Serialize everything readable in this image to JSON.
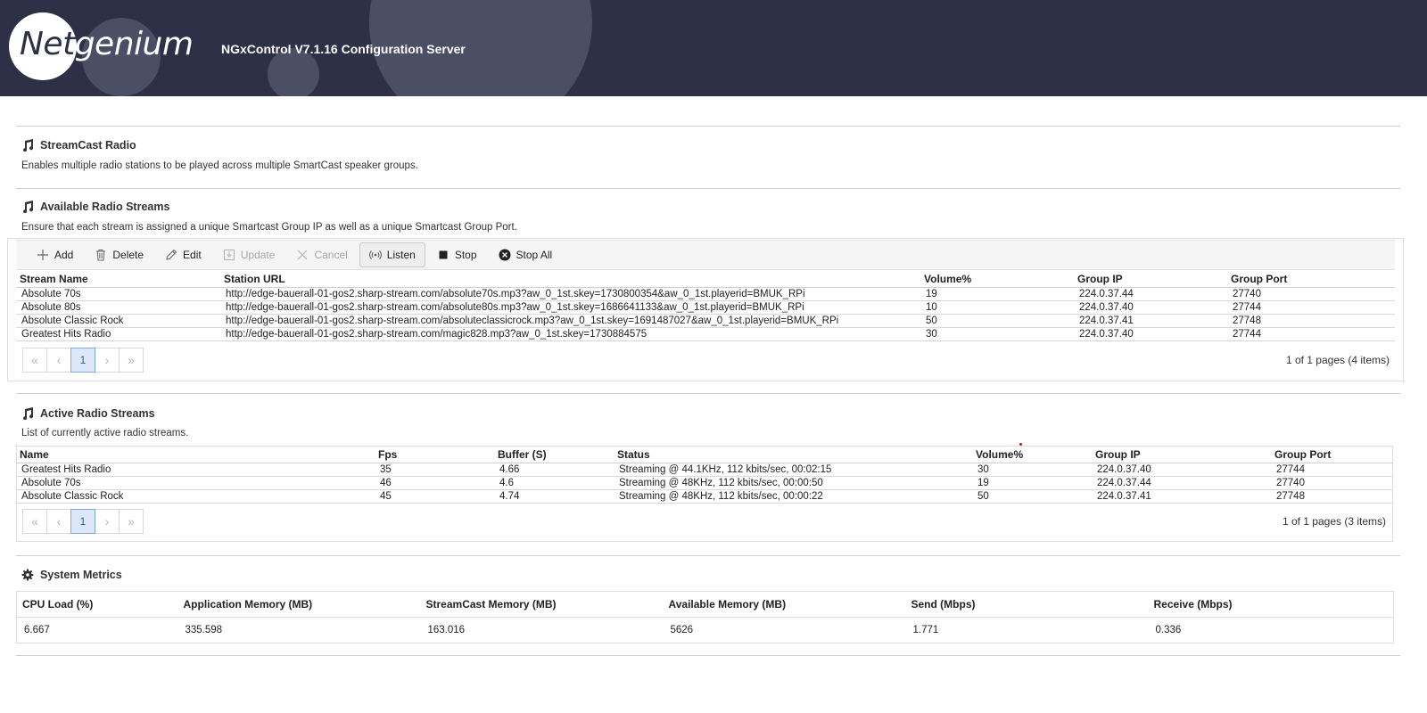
{
  "header": {
    "logo_part1": "Net",
    "logo_part2": "genium",
    "title": "NGxControl V7.1.16 Configuration Server"
  },
  "streamcast": {
    "title": "StreamCast Radio",
    "description": "Enables multiple radio stations to be played across multiple SmartCast speaker groups."
  },
  "available": {
    "title": "Available Radio Streams",
    "description": "Ensure that each stream is assigned a unique Smartcast Group IP as well as a unique Smartcast Group Port.",
    "toolbar": {
      "add": "Add",
      "delete": "Delete",
      "edit": "Edit",
      "update": "Update",
      "cancel": "Cancel",
      "listen": "Listen",
      "stop": "Stop",
      "stop_all": "Stop All"
    },
    "columns": [
      "Stream Name",
      "Station URL",
      "Volume%",
      "Group IP",
      "Group Port"
    ],
    "rows": [
      [
        "Absolute 70s",
        "http://edge-bauerall-01-gos2.sharp-stream.com/absolute70s.mp3?aw_0_1st.skey=1730800354&aw_0_1st.playerid=BMUK_RPi",
        "19",
        "224.0.37.44",
        "27740"
      ],
      [
        "Absolute 80s",
        "http://edge-bauerall-01-gos2.sharp-stream.com/absolute80s.mp3?aw_0_1st.skey=1686641133&aw_0_1st.playerid=BMUK_RPi",
        "10",
        "224.0.37.40",
        "27744"
      ],
      [
        "Absolute Classic Rock",
        "http://edge-bauerall-01-gos2.sharp-stream.com/absoluteclassicrock.mp3?aw_0_1st.skey=1691487027&aw_0_1st.playerid=BMUK_RPi",
        "50",
        "224.0.37.41",
        "27748"
      ],
      [
        "Greatest Hits Radio",
        "http://edge-bauerall-01-gos2.sharp-stream.com/magic828.mp3?aw_0_1st.skey=1730884575",
        "30",
        "224.0.37.40",
        "27744"
      ]
    ],
    "pager": {
      "first": "«",
      "prev": "‹",
      "current": "1",
      "next": "›",
      "last": "»",
      "info": "1 of 1 pages (4 items)"
    }
  },
  "active": {
    "title": "Active Radio Streams",
    "description": "List of currently active radio streams.",
    "columns": [
      "Name",
      "Fps",
      "Buffer (S)",
      "Status",
      "Volume%",
      "Group IP",
      "Group Port"
    ],
    "rows": [
      [
        "Greatest Hits Radio",
        "35",
        "4.66",
        "Streaming @ 44.1KHz, 112 kbits/sec, 00:02:15",
        "30",
        "224.0.37.40",
        "27744"
      ],
      [
        "Absolute 70s",
        "46",
        "4.6",
        "Streaming @ 48KHz, 112 kbits/sec, 00:00:50",
        "19",
        "224.0.37.44",
        "27740"
      ],
      [
        "Absolute Classic Rock",
        "45",
        "4.74",
        "Streaming @ 48KHz, 112 kbits/sec, 00:00:22",
        "50",
        "224.0.37.41",
        "27748"
      ]
    ],
    "pager": {
      "first": "«",
      "prev": "‹",
      "current": "1",
      "next": "›",
      "last": "»",
      "info": "1 of 1 pages (3 items)"
    }
  },
  "metrics": {
    "title": "System Metrics",
    "columns": [
      "CPU Load (%)",
      "Application Memory (MB)",
      "StreamCast Memory (MB)",
      "Available Memory (MB)",
      "Send (Mbps)",
      "Receive (Mbps)"
    ],
    "values": [
      "6.667",
      "335.598",
      "163.016",
      "5626",
      "1.771",
      "0.336"
    ]
  },
  "colors": {
    "header_bg": "#2d3047",
    "header_deco": "#4b4f66",
    "pager_active": "#dce8f7"
  }
}
